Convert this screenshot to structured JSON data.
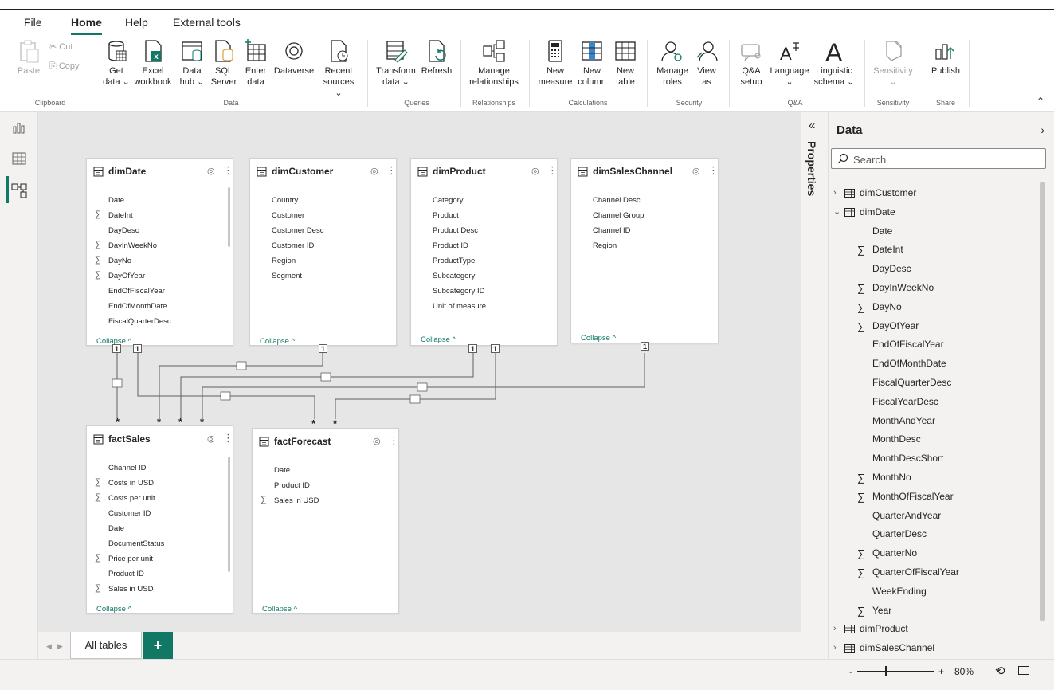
{
  "menu": {
    "tabs": [
      {
        "label": "File"
      },
      {
        "label": "Home"
      },
      {
        "label": "Help"
      },
      {
        "label": "External tools"
      }
    ]
  },
  "ribbon": {
    "clipboard": {
      "paste": "Paste",
      "cut": "Cut",
      "copy": "Copy",
      "group": "Clipboard"
    },
    "data": {
      "get_data": [
        "Get",
        "data ⌄"
      ],
      "excel": [
        "Excel",
        "workbook"
      ],
      "data_hub": [
        "Data",
        "hub ⌄"
      ],
      "sql": [
        "SQL",
        "Server"
      ],
      "enter": [
        "Enter",
        "data"
      ],
      "dataverse": [
        "Dataverse",
        ""
      ],
      "recent": [
        "Recent",
        "sources ⌄"
      ],
      "group": "Data"
    },
    "queries": {
      "transform": [
        "Transform",
        "data ⌄"
      ],
      "refresh": [
        "Refresh",
        ""
      ],
      "group": "Queries"
    },
    "relationships": {
      "manage": [
        "Manage",
        "relationships"
      ],
      "group": "Relationships"
    },
    "calculations": {
      "new_measure": [
        "New",
        "measure"
      ],
      "new_column": [
        "New",
        "column"
      ],
      "new_table": [
        "New",
        "table"
      ],
      "group": "Calculations"
    },
    "security": {
      "manage_roles": [
        "Manage",
        "roles"
      ],
      "view_as": [
        "View",
        "as"
      ],
      "group": "Security"
    },
    "qa": {
      "qa_setup": [
        "Q&A",
        "setup"
      ],
      "language": [
        "Language",
        "⌄"
      ],
      "linguistic": [
        "Linguistic",
        "schema ⌄"
      ],
      "group": "Q&A"
    },
    "sensitivity": {
      "label": [
        "Sensitivity",
        "⌄"
      ],
      "group": "Sensitivity"
    },
    "share": {
      "publish": [
        "Publish",
        ""
      ],
      "group": "Share"
    }
  },
  "model": {
    "tables": [
      {
        "name": "dimDate",
        "collapse": "Collapse ^",
        "fields": [
          {
            "name": "Date",
            "sum": false
          },
          {
            "name": "DateInt",
            "sum": true
          },
          {
            "name": "DayDesc",
            "sum": false
          },
          {
            "name": "DayInWeekNo",
            "sum": true
          },
          {
            "name": "DayNo",
            "sum": true
          },
          {
            "name": "DayOfYear",
            "sum": true
          },
          {
            "name": "EndOfFiscalYear",
            "sum": false
          },
          {
            "name": "EndOfMonthDate",
            "sum": false
          },
          {
            "name": "FiscalQuarterDesc",
            "sum": false
          }
        ]
      },
      {
        "name": "dimCustomer",
        "collapse": "Collapse ^",
        "fields": [
          {
            "name": "Country",
            "sum": false
          },
          {
            "name": "Customer",
            "sum": false
          },
          {
            "name": "Customer Desc",
            "sum": false
          },
          {
            "name": "Customer ID",
            "sum": false
          },
          {
            "name": "Region",
            "sum": false
          },
          {
            "name": "Segment",
            "sum": false
          }
        ]
      },
      {
        "name": "dimProduct",
        "collapse": "Collapse ^",
        "fields": [
          {
            "name": "Category",
            "sum": false
          },
          {
            "name": "Product",
            "sum": false
          },
          {
            "name": "Product Desc",
            "sum": false
          },
          {
            "name": "Product ID",
            "sum": false
          },
          {
            "name": "ProductType",
            "sum": false
          },
          {
            "name": "Subcategory",
            "sum": false
          },
          {
            "name": "Subcategory ID",
            "sum": false
          },
          {
            "name": "Unit of measure",
            "sum": false
          }
        ]
      },
      {
        "name": "dimSalesChannel",
        "collapse": "Collapse ^",
        "fields": [
          {
            "name": "Channel Desc",
            "sum": false
          },
          {
            "name": "Channel Group",
            "sum": false
          },
          {
            "name": "Channel ID",
            "sum": false
          },
          {
            "name": "Region",
            "sum": false
          }
        ]
      },
      {
        "name": "factSales",
        "collapse": "Collapse ^",
        "fields": [
          {
            "name": "Channel ID",
            "sum": false
          },
          {
            "name": "Costs in USD",
            "sum": true
          },
          {
            "name": "Costs per unit",
            "sum": true
          },
          {
            "name": "Customer ID",
            "sum": false
          },
          {
            "name": "Date",
            "sum": false
          },
          {
            "name": "DocumentStatus",
            "sum": false
          },
          {
            "name": "Price per unit",
            "sum": true
          },
          {
            "name": "Product ID",
            "sum": false
          },
          {
            "name": "Sales in USD",
            "sum": true
          }
        ]
      },
      {
        "name": "factForecast",
        "collapse": "Collapse ^",
        "fields": [
          {
            "name": "Date",
            "sum": false
          },
          {
            "name": "Product ID",
            "sum": false
          },
          {
            "name": "Sales in USD",
            "sum": true
          }
        ]
      }
    ],
    "cardinality": {
      "one": "1",
      "many": "*"
    }
  },
  "bottom": {
    "all_tables": "All tables",
    "add": "+"
  },
  "properties": {
    "label": "Properties",
    "collapse_icon": "«"
  },
  "data_pane": {
    "title": "Data",
    "search_placeholder": "Search",
    "tree": [
      {
        "kind": "table",
        "name": "dimCustomer",
        "expanded": false
      },
      {
        "kind": "table",
        "name": "dimDate",
        "expanded": true
      },
      {
        "kind": "field",
        "name": "Date",
        "sum": false
      },
      {
        "kind": "field",
        "name": "DateInt",
        "sum": true
      },
      {
        "kind": "field",
        "name": "DayDesc",
        "sum": false
      },
      {
        "kind": "field",
        "name": "DayInWeekNo",
        "sum": true
      },
      {
        "kind": "field",
        "name": "DayNo",
        "sum": true
      },
      {
        "kind": "field",
        "name": "DayOfYear",
        "sum": true
      },
      {
        "kind": "field",
        "name": "EndOfFiscalYear",
        "sum": false
      },
      {
        "kind": "field",
        "name": "EndOfMonthDate",
        "sum": false
      },
      {
        "kind": "field",
        "name": "FiscalQuarterDesc",
        "sum": false
      },
      {
        "kind": "field",
        "name": "FiscalYearDesc",
        "sum": false
      },
      {
        "kind": "field",
        "name": "MonthAndYear",
        "sum": false
      },
      {
        "kind": "field",
        "name": "MonthDesc",
        "sum": false
      },
      {
        "kind": "field",
        "name": "MonthDescShort",
        "sum": false
      },
      {
        "kind": "field",
        "name": "MonthNo",
        "sum": true
      },
      {
        "kind": "field",
        "name": "MonthOfFiscalYear",
        "sum": true
      },
      {
        "kind": "field",
        "name": "QuarterAndYear",
        "sum": false
      },
      {
        "kind": "field",
        "name": "QuarterDesc",
        "sum": false
      },
      {
        "kind": "field",
        "name": "QuarterNo",
        "sum": true
      },
      {
        "kind": "field",
        "name": "QuarterOfFiscalYear",
        "sum": true
      },
      {
        "kind": "field",
        "name": "WeekEnding",
        "sum": false
      },
      {
        "kind": "field",
        "name": "Year",
        "sum": true
      },
      {
        "kind": "table",
        "name": "dimProduct",
        "expanded": false
      },
      {
        "kind": "table",
        "name": "dimSalesChannel",
        "expanded": false
      }
    ]
  },
  "status": {
    "zoom_minus": "-",
    "zoom_plus": "+",
    "zoom_level": "80%"
  },
  "colors": {
    "accent": "#117865",
    "canvas": "#e6e6e6"
  }
}
